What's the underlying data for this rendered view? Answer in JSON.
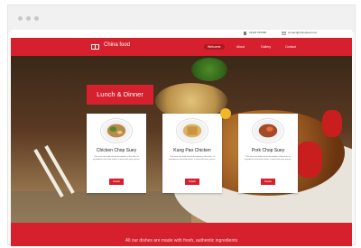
{
  "topbar": {
    "phone": "01234 567890",
    "email": "contact@chinafood.com"
  },
  "nav": {
    "logo": "China food",
    "items": [
      "Welcome",
      "About",
      "Gallery",
      "Contact"
    ]
  },
  "hero": {
    "banner": "Lunch & Dinner"
  },
  "cards": [
    {
      "title": "Chicken Chop Suey",
      "desc": "This area can hold a brief description of the dish, its ingredients and what makes it special for your guests.",
      "button": "Details"
    },
    {
      "title": "Kung Pao Chicken",
      "desc": "This area can hold a brief description of the dish, its ingredients and what makes it special for your guests.",
      "button": "Details"
    },
    {
      "title": "Pork Chop Suey",
      "desc": "This area can hold a brief description of the dish, its ingredients and what makes it special for your guests.",
      "button": "Details"
    }
  ],
  "footer": {
    "text": "All our dishes are made with fresh, authentic ingredients"
  },
  "colors": {
    "accent": "#d6202d",
    "badge": "#f0b828"
  }
}
